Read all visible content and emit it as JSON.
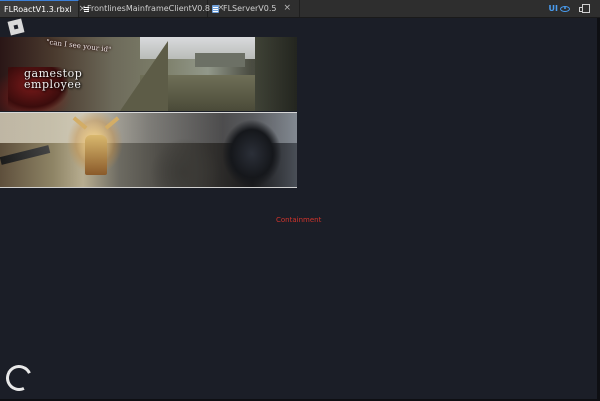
{
  "tabs": [
    {
      "label": "FLRoactV1.3.rbxl",
      "close": "×",
      "active": true
    },
    {
      "label": "FrontlinesMainframeClientV0.8",
      "close": "×",
      "active": false
    },
    {
      "label": "FLServerV0.5",
      "close": "×",
      "active": false
    }
  ],
  "toolbar": {
    "ui_toggle_label": "UI",
    "ui_toggle_icon": "eye-icon",
    "window_icon": "window-restore-icon"
  },
  "viewport": {
    "logo_icon": "roblox-logo-icon",
    "image_top": {
      "quote_caption": "\"can I see your id\"",
      "main_caption_line1": "gamestop",
      "main_caption_line2": "employee"
    },
    "status_text": "Containment",
    "spinner_icon": "loading-spinner-icon"
  },
  "colors": {
    "background": "#1b1e26",
    "tabbar": "#2e2e2e",
    "accent": "#4a9df0",
    "status_red": "#d0342c"
  }
}
